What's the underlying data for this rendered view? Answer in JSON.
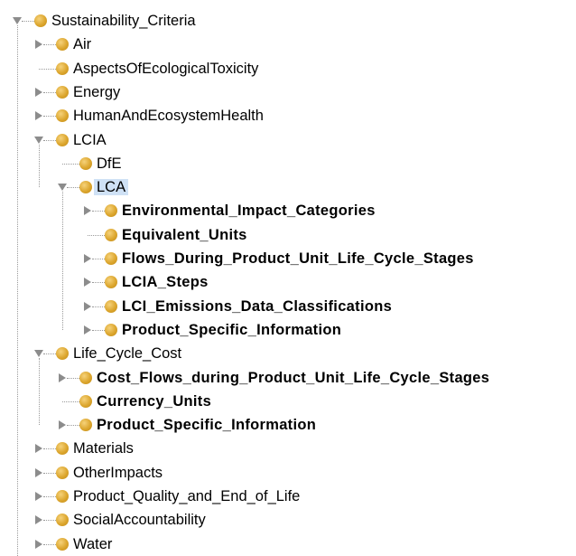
{
  "colors": {
    "node": "#d9a22c",
    "selection": "#cfe1f5",
    "connector": "#9a9a9a"
  },
  "tree": {
    "root": {
      "label": "Sustainability_Criteria",
      "state": "expanded",
      "icon": "class-node-icon"
    },
    "items": [
      {
        "label": "Air",
        "state": "collapsed",
        "bold": false
      },
      {
        "label": "AspectsOfEcologicalToxicity",
        "state": "leaf",
        "bold": false
      },
      {
        "label": "Energy",
        "state": "collapsed",
        "bold": false
      },
      {
        "label": "HumanAndEcosystemHealth",
        "state": "collapsed",
        "bold": false
      },
      {
        "label": "LCIA",
        "state": "expanded",
        "bold": false
      },
      {
        "label": "DfE",
        "state": "leaf",
        "bold": false
      },
      {
        "label": "LCA",
        "state": "expanded",
        "bold": false,
        "selected": true
      },
      {
        "label": "Environmental_Impact_Categories",
        "state": "collapsed",
        "bold": true
      },
      {
        "label": "Equivalent_Units",
        "state": "leaf",
        "bold": true
      },
      {
        "label": "Flows_During_Product_Unit_Life_Cycle_Stages",
        "state": "collapsed",
        "bold": true
      },
      {
        "label": "LCIA_Steps",
        "state": "collapsed",
        "bold": true
      },
      {
        "label": "LCI_Emissions_Data_Classifications",
        "state": "collapsed",
        "bold": true
      },
      {
        "label": "Product_Specific_Information",
        "state": "collapsed",
        "bold": true
      },
      {
        "label": "Life_Cycle_Cost",
        "state": "expanded",
        "bold": false
      },
      {
        "label": "Cost_Flows_during_Product_Unit_Life_Cycle_Stages",
        "state": "collapsed",
        "bold": true
      },
      {
        "label": "Currency_Units",
        "state": "leaf",
        "bold": true
      },
      {
        "label": "Product_Specific_Information",
        "state": "collapsed",
        "bold": true
      },
      {
        "label": "Materials",
        "state": "collapsed",
        "bold": false
      },
      {
        "label": "OtherImpacts",
        "state": "collapsed",
        "bold": false
      },
      {
        "label": "Product_Quality_and_End_of_Life",
        "state": "collapsed",
        "bold": false
      },
      {
        "label": "SocialAccountability",
        "state": "collapsed",
        "bold": false
      },
      {
        "label": "Water",
        "state": "collapsed",
        "bold": false
      }
    ]
  }
}
